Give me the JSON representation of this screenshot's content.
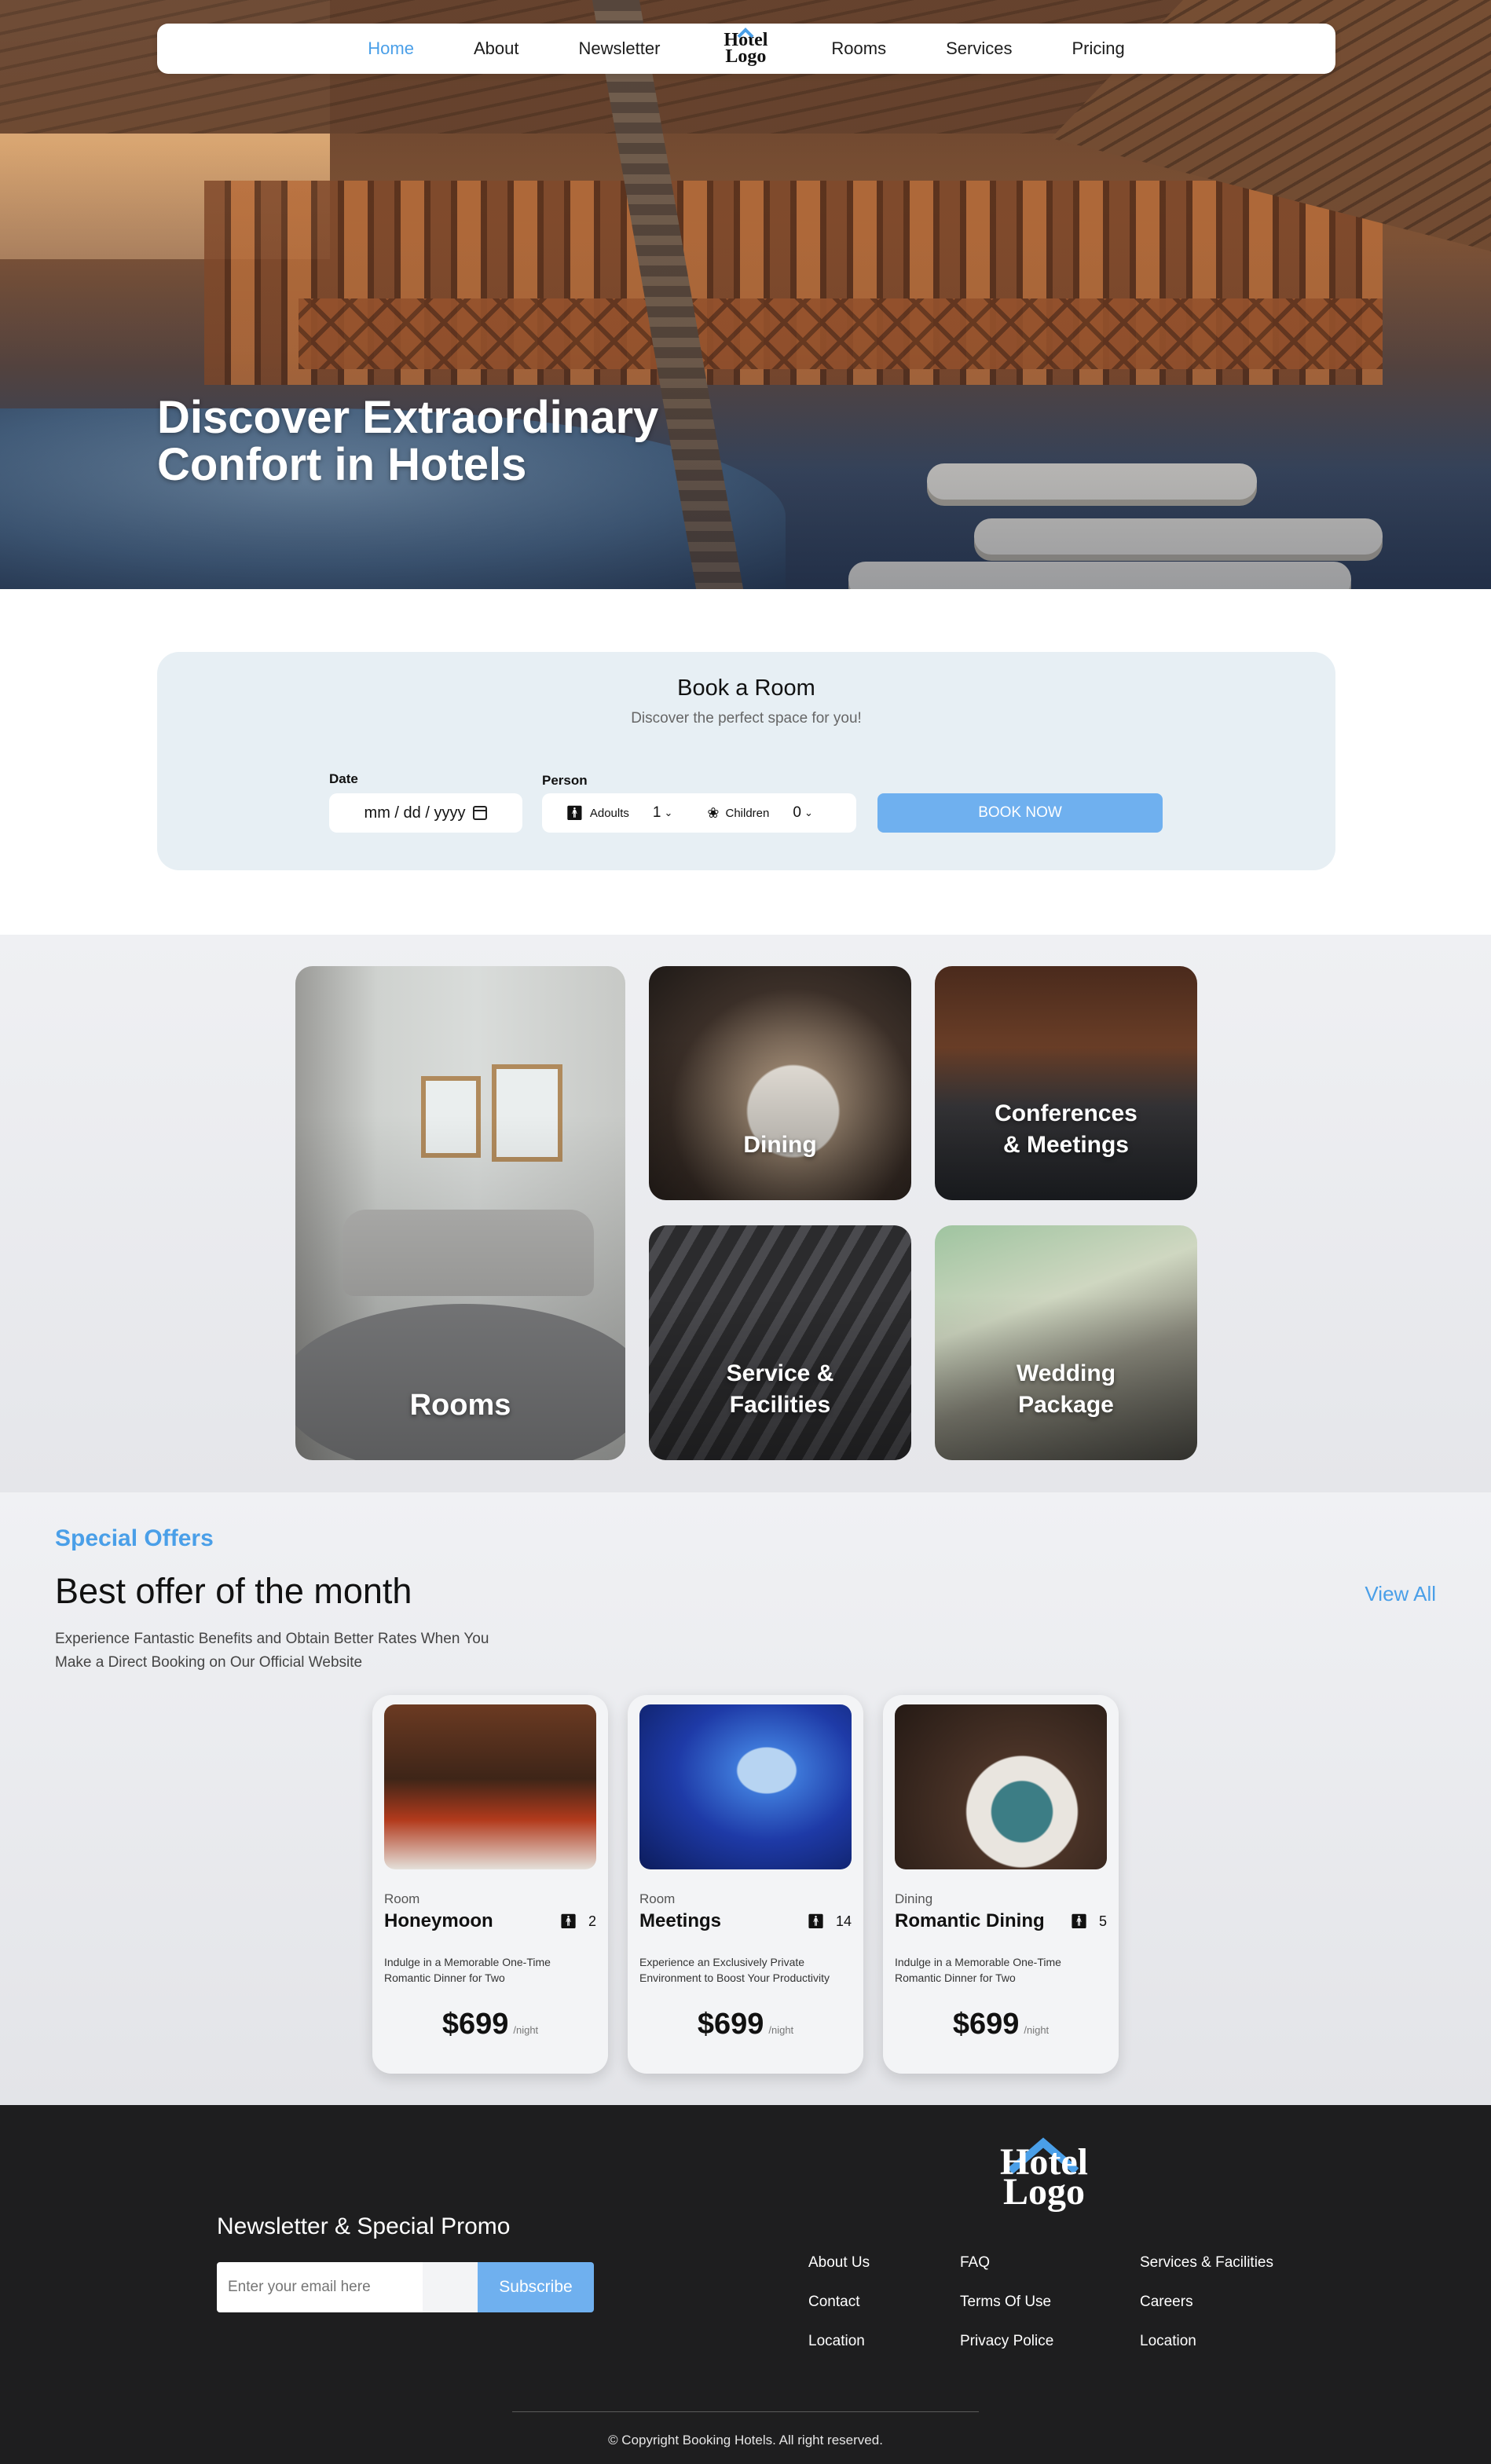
{
  "nav": {
    "items": [
      "Home",
      "About",
      "Newsletter",
      "Rooms",
      "Services",
      "Pricing"
    ],
    "active": "Home",
    "logo_line1": "Hotel",
    "logo_line2": "Logo"
  },
  "hero": {
    "title_line1": "Discover Extraordinary",
    "title_line2": "Confort in Hotels"
  },
  "booking": {
    "title": "Book a Room",
    "subtitle": "Discover the perfect space for you!",
    "date_label": "Date",
    "date_placeholder": "mm / dd / yyyy",
    "person_label": "Person",
    "adults_label": "Adoults",
    "adults_value": "1",
    "children_label": "Children",
    "children_value": "0",
    "button": "BOOK NOW"
  },
  "categories": {
    "rooms": "Rooms",
    "dining": "Dining",
    "conferences_line1": "Conferences",
    "conferences_line2": "& Meetings",
    "service_line1": "Service &",
    "service_line2": "Facilities",
    "wedding_line1": "Wedding",
    "wedding_line2": "Package"
  },
  "offers": {
    "kicker": "Special Offers",
    "heading": "Best offer of the month",
    "description_line1": "Experience Fantastic Benefits and Obtain Better Rates When You",
    "description_line2": "Make a Direct Booking on Our Official Website",
    "view_all": "View All",
    "cards": [
      {
        "category": "Room",
        "name": "Honeymoon",
        "capacity": "2",
        "blurb": "Indulge in a Memorable One-Time Romantic Dinner for Two",
        "price": "$699",
        "unit": "/night"
      },
      {
        "category": "Room",
        "name": "Meetings",
        "capacity": "14",
        "blurb": "Experience an Exclusively Private Environment to Boost Your Productivity",
        "price": "$699",
        "unit": "/night"
      },
      {
        "category": "Dining",
        "name": "Romantic Dining",
        "capacity": "5",
        "blurb": "Indulge in a Memorable One-Time Romantic Dinner for Two",
        "price": "$699",
        "unit": "/night"
      }
    ]
  },
  "footer": {
    "logo_line1": "Hotel",
    "logo_line2": "Logo",
    "newsletter_title": "Newsletter & Special Promo",
    "email_placeholder": "Enter your email here",
    "subscribe": "Subscribe",
    "col1": [
      "About Us",
      "Contact",
      "Location"
    ],
    "col2": [
      "FAQ",
      "Terms Of Use",
      "Privacy Police"
    ],
    "col3": [
      "Services & Facilities",
      "Careers",
      "Location"
    ],
    "copyright": "© Copyright Booking Hotels. All right reserved."
  },
  "colors": {
    "accent": "#4a9fe8",
    "button": "#6fb0ef",
    "booking_panel": "#e7eff4",
    "footer_bg": "#1e1e1f"
  },
  "icons": [
    "calendar-icon",
    "adult-icon",
    "child-icon",
    "chevron-down-icon",
    "person-icon",
    "logo-roof-icon"
  ]
}
